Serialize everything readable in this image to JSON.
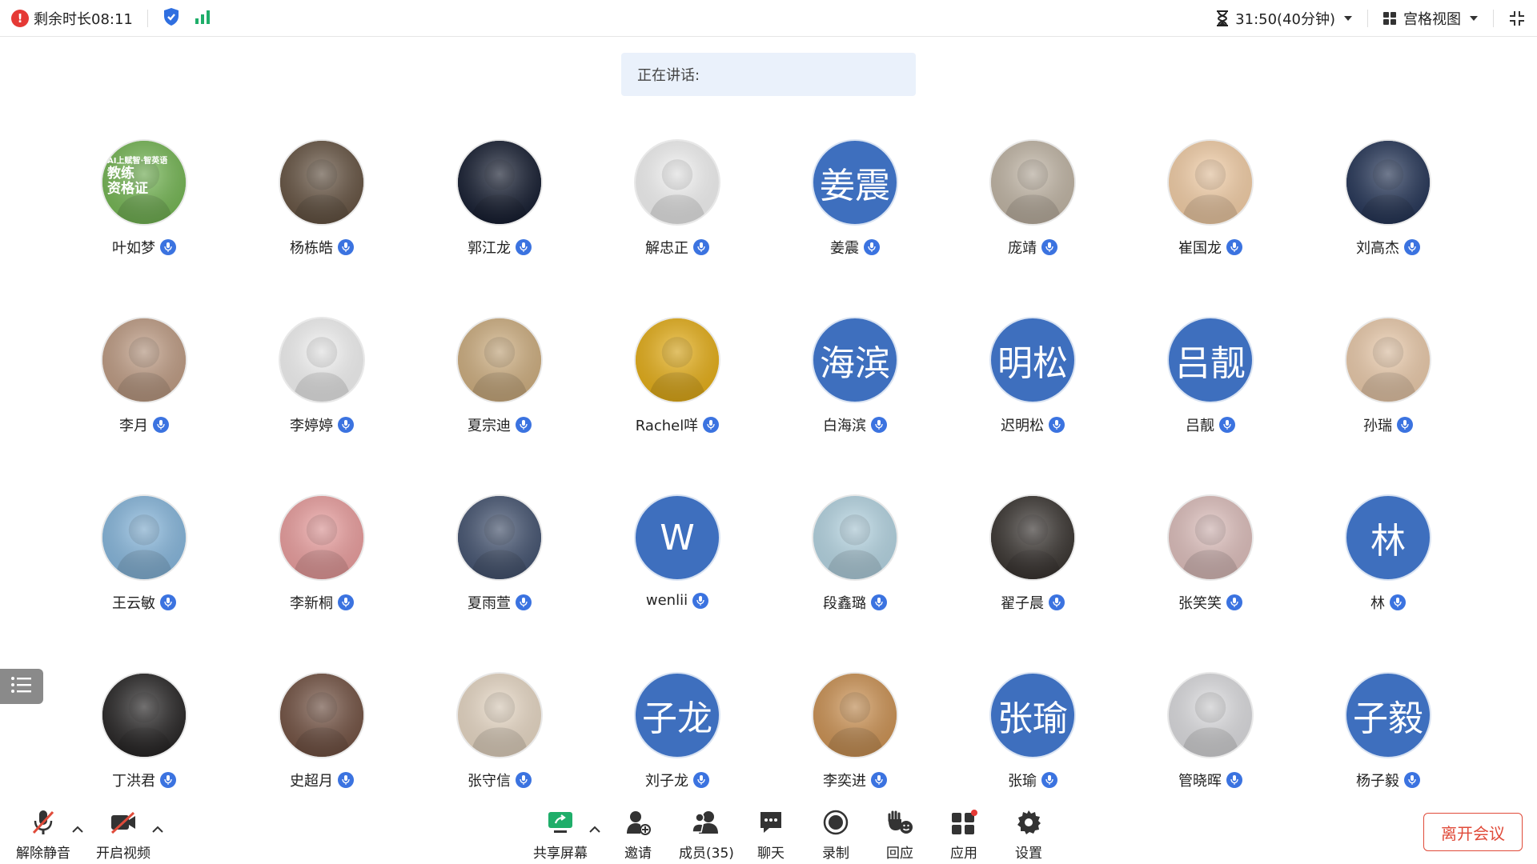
{
  "topbar": {
    "remaining_time": "剩余时长08:11",
    "meeting_timer": "31:50(40分钟)",
    "view_mode": "宫格视图"
  },
  "speaking_banner": "正在讲话:",
  "participants": [
    {
      "name": "叶如梦",
      "avatar": "photo",
      "bg": "#7cc05a",
      "initials": ""
    },
    {
      "name": "杨栋皓",
      "avatar": "photo",
      "bg": "#6d5a48",
      "initials": ""
    },
    {
      "name": "郭江龙",
      "avatar": "photo",
      "bg": "#1a2236",
      "initials": ""
    },
    {
      "name": "解忠正",
      "avatar": "cartoon",
      "bg": "#ffffff",
      "initials": ""
    },
    {
      "name": "姜震",
      "avatar": "text",
      "bg": "#3e6fbe",
      "initials": "姜震"
    },
    {
      "name": "庞靖",
      "avatar": "photo",
      "bg": "#cbbfae",
      "initials": ""
    },
    {
      "name": "崔国龙",
      "avatar": "cartoon",
      "bg": "#ffd9b0",
      "initials": ""
    },
    {
      "name": "刘高杰",
      "avatar": "photo",
      "bg": "#2a3b5e",
      "initials": ""
    },
    {
      "name": "李月",
      "avatar": "photo",
      "bg": "#c9a58c",
      "initials": ""
    },
    {
      "name": "李婷婷",
      "avatar": "cartoon",
      "bg": "#ffffff",
      "initials": ""
    },
    {
      "name": "夏宗迪",
      "avatar": "photo",
      "bg": "#d9b888",
      "initials": ""
    },
    {
      "name": "Rachel咩",
      "avatar": "photo",
      "bg": "#f1b81c",
      "initials": ""
    },
    {
      "name": "白海滨",
      "avatar": "text",
      "bg": "#3e6fbe",
      "initials": "海滨"
    },
    {
      "name": "迟明松",
      "avatar": "text",
      "bg": "#3e6fbe",
      "initials": "明松"
    },
    {
      "name": "吕靓",
      "avatar": "text",
      "bg": "#3e6fbe",
      "initials": "吕靓"
    },
    {
      "name": "孙瑞",
      "avatar": "cartoon",
      "bg": "#f6d5b4",
      "initials": ""
    },
    {
      "name": "王云敏",
      "avatar": "photo",
      "bg": "#8fc1e8",
      "initials": ""
    },
    {
      "name": "李新桐",
      "avatar": "cartoon",
      "bg": "#f6a7a7",
      "initials": ""
    },
    {
      "name": "夏雨萱",
      "avatar": "photo",
      "bg": "#4a5a78",
      "initials": ""
    },
    {
      "name": "wenlii",
      "avatar": "text",
      "bg": "#3e6fbe",
      "initials": "W"
    },
    {
      "name": "段鑫璐",
      "avatar": "photo",
      "bg": "#bfe0ee",
      "initials": ""
    },
    {
      "name": "翟子晨",
      "avatar": "photo",
      "bg": "#3f3a36",
      "initials": ""
    },
    {
      "name": "张笑笑",
      "avatar": "photo",
      "bg": "#e9c9c6",
      "initials": ""
    },
    {
      "name": "林",
      "avatar": "text",
      "bg": "#3e6fbe",
      "initials": "林"
    },
    {
      "name": "丁洪君",
      "avatar": "cartoon",
      "bg": "#2c2a2a",
      "initials": ""
    },
    {
      "name": "史超月",
      "avatar": "photo",
      "bg": "#7a5848",
      "initials": ""
    },
    {
      "name": "张守信",
      "avatar": "photo",
      "bg": "#f3e3cf",
      "initials": ""
    },
    {
      "name": "刘子龙",
      "avatar": "text",
      "bg": "#3e6fbe",
      "initials": "子龙"
    },
    {
      "name": "李奕进",
      "avatar": "photo",
      "bg": "#d79b5a",
      "initials": ""
    },
    {
      "name": "张瑜",
      "avatar": "text",
      "bg": "#3e6fbe",
      "initials": "张瑜"
    },
    {
      "name": "管晓晖",
      "avatar": "photo",
      "bg": "#e7e7ea",
      "initials": ""
    },
    {
      "name": "杨子毅",
      "avatar": "text",
      "bg": "#3e6fbe",
      "initials": "子毅"
    }
  ],
  "participant_card_text": [
    "AI上赋智·智英语",
    "教练",
    "资格证"
  ],
  "toolbar": {
    "unmute": "解除静音",
    "start_video": "开启视频",
    "share_screen": "共享屏幕",
    "invite": "邀请",
    "members": "成员(35)",
    "chat": "聊天",
    "record": "录制",
    "react": "回应",
    "apps": "应用",
    "settings": "设置",
    "leave": "离开会议"
  },
  "colors": {
    "accent": "#3b73e0",
    "danger": "#e04b3a",
    "share_green": "#1fae6a",
    "avatar_blue": "#3e6fbe"
  }
}
